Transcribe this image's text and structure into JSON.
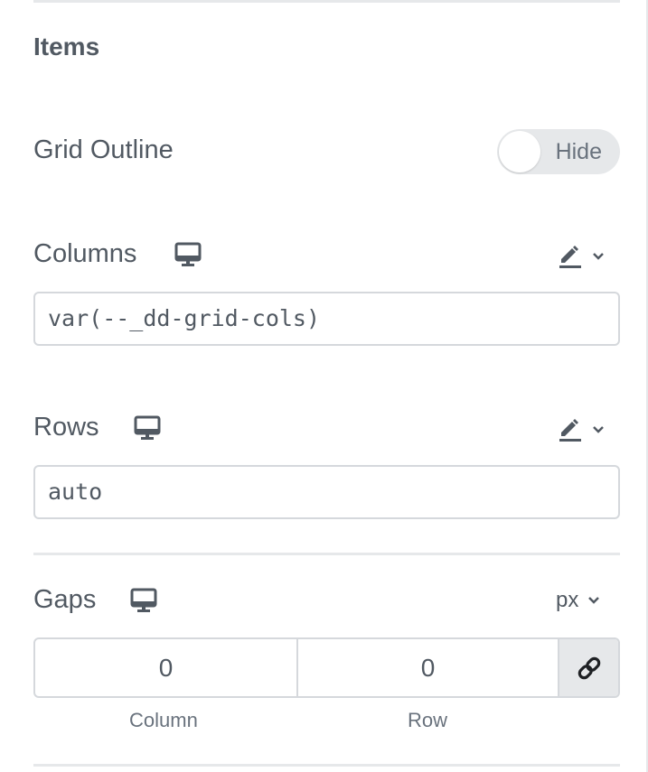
{
  "section": {
    "title": "Items"
  },
  "grid_outline": {
    "label": "Grid Outline",
    "toggle_text": "Hide",
    "state": "off"
  },
  "columns": {
    "label": "Columns",
    "device_icon": "desktop-monitor-icon",
    "edit_icon": "pencil-icon",
    "value": "var(--_dd-grid-cols)"
  },
  "rows": {
    "label": "Rows",
    "device_icon": "desktop-monitor-icon",
    "edit_icon": "pencil-icon",
    "value": "auto"
  },
  "gaps": {
    "label": "Gaps",
    "device_icon": "desktop-monitor-icon",
    "unit": "px",
    "column_value": "0",
    "row_value": "0",
    "column_label": "Column",
    "row_label": "Row",
    "link_icon": "link-icon"
  },
  "colors": {
    "text": "#515962",
    "muted": "#69727d",
    "border": "#d5d8dc",
    "fill": "#e6e8ea"
  }
}
